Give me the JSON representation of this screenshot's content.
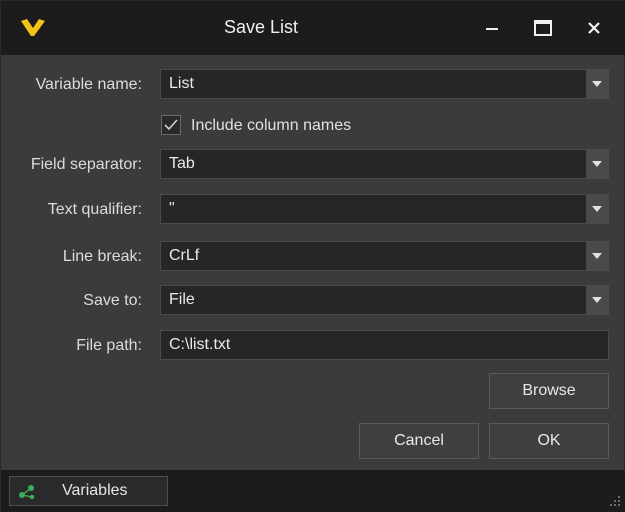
{
  "window": {
    "title": "Save List"
  },
  "form": {
    "variable_name": {
      "label": "Variable name:",
      "value": "List"
    },
    "include_columns": {
      "label": "Include column names",
      "checked": true
    },
    "field_separator": {
      "label": "Field separator:",
      "value": "Tab"
    },
    "text_qualifier": {
      "label": "Text qualifier:",
      "value": "\""
    },
    "line_break": {
      "label": "Line break:",
      "value": "CrLf"
    },
    "save_to": {
      "label": "Save to:",
      "value": "File"
    },
    "file_path": {
      "label": "File path:",
      "value": "C:\\list.txt"
    }
  },
  "buttons": {
    "browse": "Browse",
    "cancel": "Cancel",
    "ok": "OK"
  },
  "statusbar": {
    "variables_tab": "Variables"
  },
  "icons": {
    "logo": "app-logo",
    "minimize": "minimize-icon",
    "maximize": "maximize-icon",
    "close": "close-icon",
    "dropdown": "chevron-down-icon",
    "check": "checkmark-icon",
    "variables": "variables-icon",
    "grip": "resize-grip-icon"
  },
  "colors": {
    "accent": "#f2c417",
    "background": "#3b3b3b",
    "titlebar": "#1c1c1c",
    "field": "#262626"
  }
}
